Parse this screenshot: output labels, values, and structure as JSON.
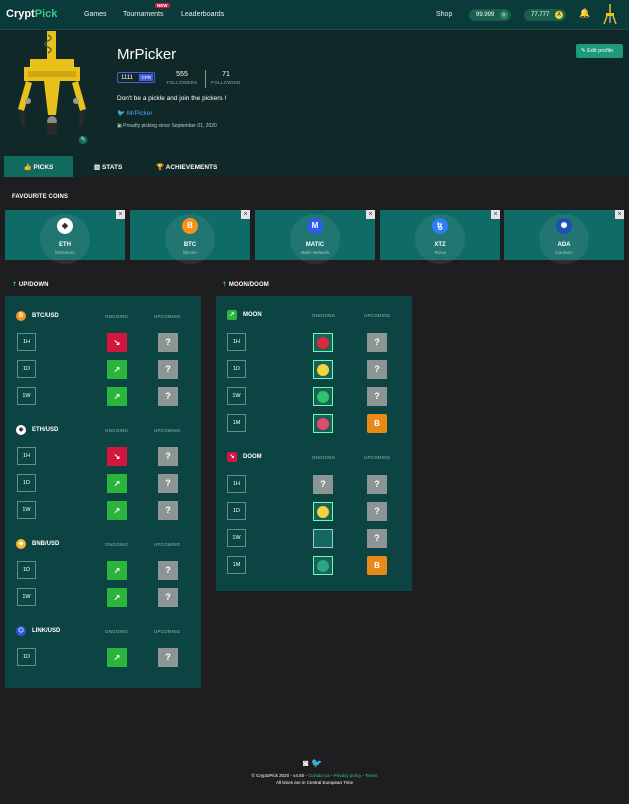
{
  "nav": {
    "logo_main": "Crypt",
    "logo_accent": "Pick",
    "links": [
      "Games",
      "Tournaments",
      "Leaderboards"
    ],
    "new_badge": "NEW",
    "shop": "Shop",
    "balance_1": "99.999",
    "balance_2": "77.777",
    "balance_2_icon": "A"
  },
  "profile": {
    "username": "MrPicker",
    "level": "1111",
    "level_tag": "CPR",
    "followers_count": "555",
    "followers_label": "FOLLOWERS",
    "following_count": "71",
    "following_label": "FOLLOWING",
    "bio": "Don't be a pickle and join the pickers !",
    "twitter": "MrPicker",
    "since": "Proudly picking since September 01, 2020",
    "edit_label": "Edit profile"
  },
  "tabs": [
    {
      "label": "PICKS",
      "icon": "thumbs-up-icon"
    },
    {
      "label": "STATS",
      "icon": "chart-icon"
    },
    {
      "label": "ACHIEVEMENTS",
      "icon": "trophy-icon"
    }
  ],
  "favourites": {
    "title": "FAVOURITE COINS",
    "coins": [
      {
        "symbol": "ETH",
        "name": "Ethereum",
        "color": "#ffffff",
        "glyph": "◆"
      },
      {
        "symbol": "BTC",
        "name": "Bitcoin",
        "color": "#f7931a",
        "glyph": "B"
      },
      {
        "symbol": "MATIC",
        "name": "Matic Network",
        "color": "#2f5bf0",
        "glyph": "M"
      },
      {
        "symbol": "XTZ",
        "name": "Tezos",
        "color": "#2c7df7",
        "glyph": "ꜩ"
      },
      {
        "symbol": "ADA",
        "name": "Cardano",
        "color": "#1d4fb5",
        "glyph": "✺"
      }
    ]
  },
  "updown": {
    "title": "UP/DOWN",
    "ongoing": "ONGOING",
    "upcoming": "UPCOMING",
    "groups": [
      {
        "pair": "BTC/USD",
        "icon_color": "#f7931a",
        "glyph": "B",
        "rows": [
          {
            "tf": "1H",
            "ongoing": "down"
          },
          {
            "tf": "1D",
            "ongoing": "up"
          },
          {
            "tf": "1W",
            "ongoing": "up"
          }
        ]
      },
      {
        "pair": "ETH/USD",
        "icon_color": "#ffffff",
        "glyph": "◆",
        "rows": [
          {
            "tf": "1H",
            "ongoing": "down"
          },
          {
            "tf": "1D",
            "ongoing": "up"
          },
          {
            "tf": "1W",
            "ongoing": "up"
          }
        ]
      },
      {
        "pair": "BNB/USD",
        "icon_color": "#f3ba2f",
        "glyph": "◈",
        "rows": [
          {
            "tf": "1D",
            "ongoing": "up"
          },
          {
            "tf": "1W",
            "ongoing": "up"
          }
        ]
      },
      {
        "pair": "LINK/USD",
        "icon_color": "#2a5ada",
        "glyph": "⬡",
        "rows": [
          {
            "tf": "1D",
            "ongoing": "up"
          }
        ]
      }
    ]
  },
  "moondoom": {
    "title": "MOON/DOOM",
    "ongoing": "ONGOING",
    "upcoming": "UPCOMING",
    "moon": {
      "label": "MOON",
      "rows": [
        {
          "tf": "1H",
          "ongoing": "coin-red",
          "upcoming": "unknown"
        },
        {
          "tf": "1D",
          "ongoing": "coin-smiley",
          "upcoming": "unknown"
        },
        {
          "tf": "1W",
          "ongoing": "coin-green",
          "upcoming": "unknown"
        },
        {
          "tf": "1M",
          "ongoing": "coin-pink",
          "upcoming": "btc"
        }
      ]
    },
    "doom": {
      "label": "DOOM",
      "rows": [
        {
          "tf": "1H",
          "ongoing": "unknown",
          "upcoming": "unknown"
        },
        {
          "tf": "1D",
          "ongoing": "coin-smiley",
          "upcoming": "unknown"
        },
        {
          "tf": "1W",
          "ongoing": "empty",
          "upcoming": "unknown"
        },
        {
          "tf": "1M",
          "ongoing": "coin-teal",
          "upcoming": "btc"
        }
      ]
    }
  },
  "footer": {
    "copyright": "© CryptoPick 2020 - v4.50 - ",
    "contact": "Contact us",
    "privacy": "Privacy policy",
    "terms": "Terms",
    "sep": " - ",
    "timezone": "All times are in Central European Time"
  }
}
